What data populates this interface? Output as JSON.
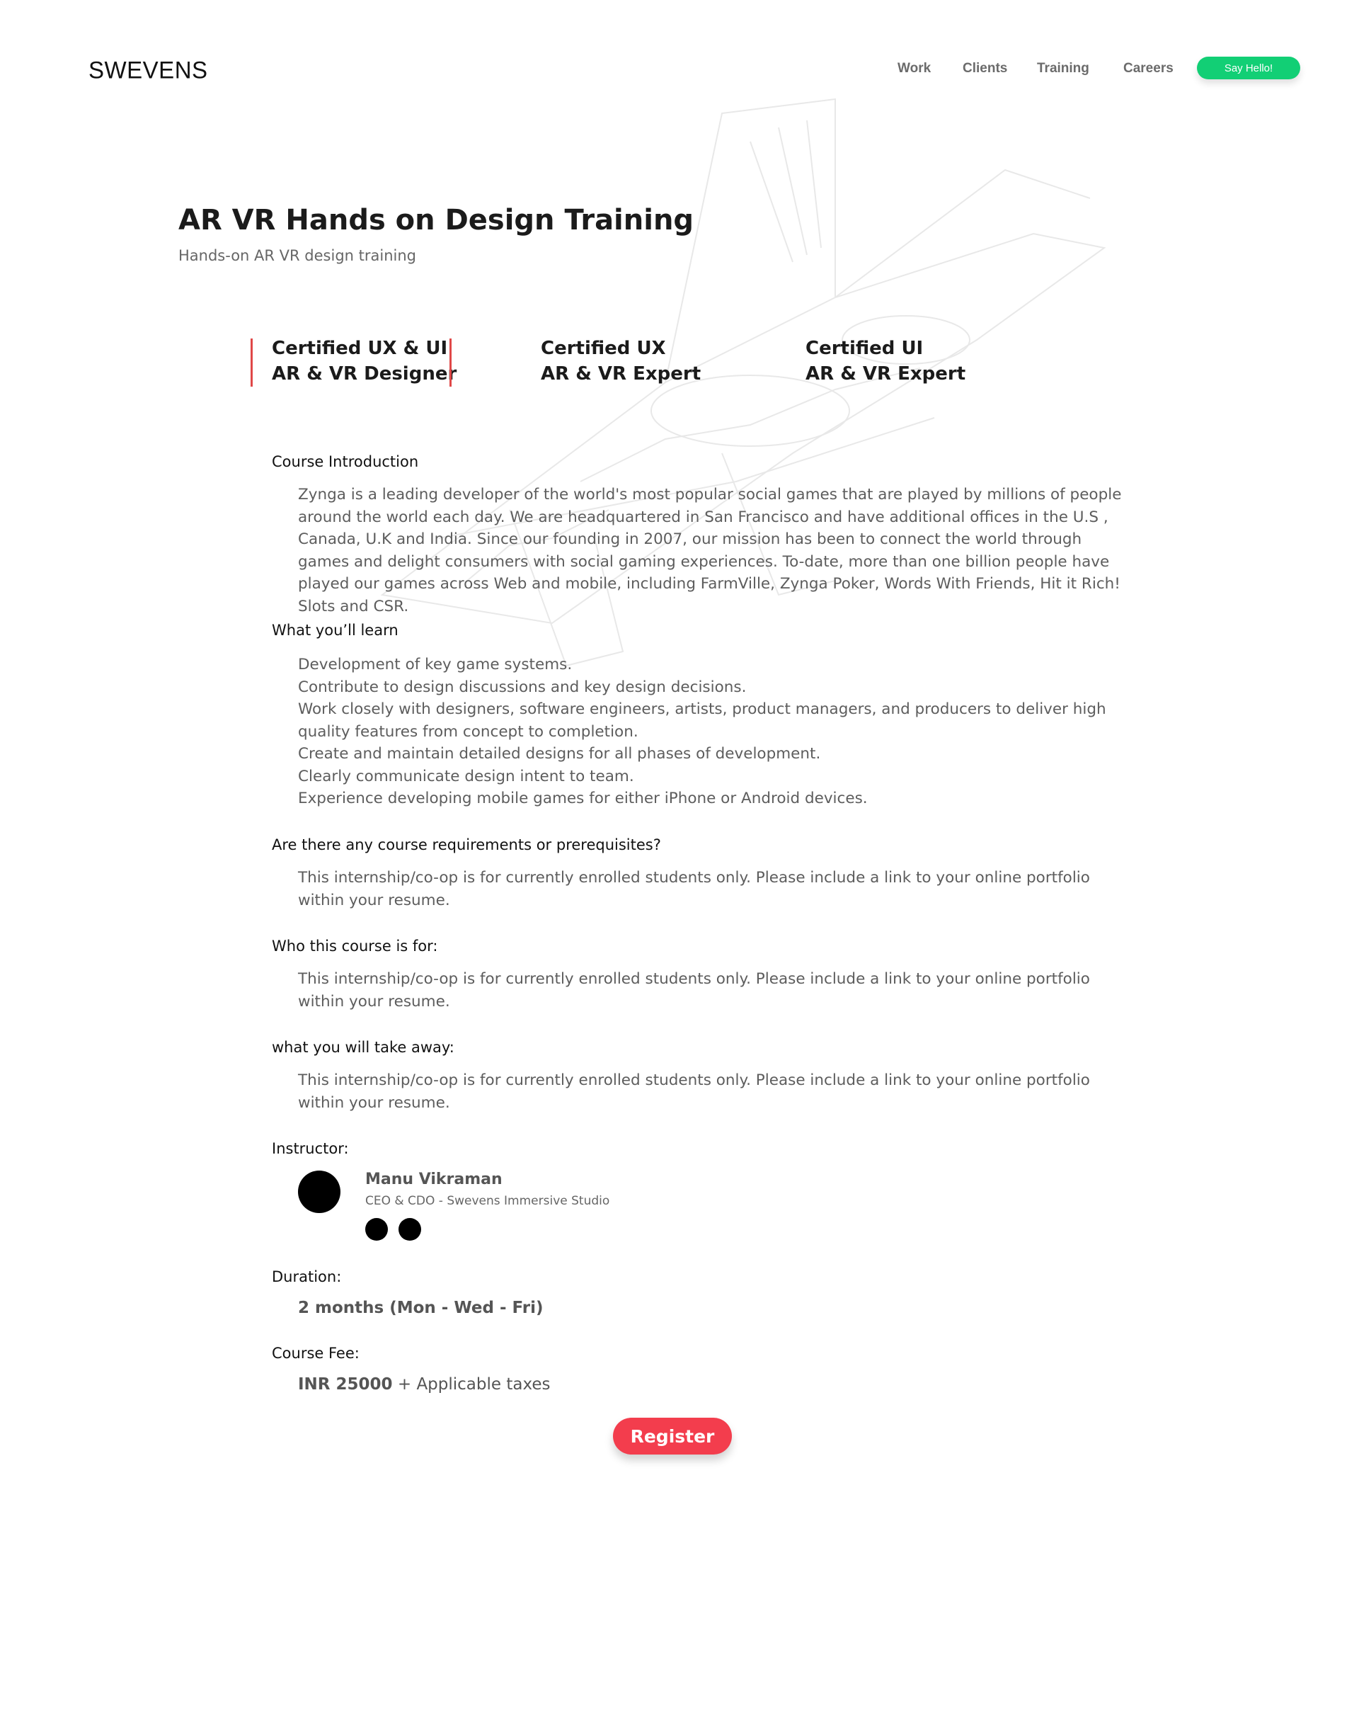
{
  "header": {
    "logo": "SWEVENS",
    "nav": [
      "Work",
      "Clients",
      "Training",
      "Careers"
    ],
    "cta": "Say Hello!"
  },
  "page": {
    "title": "AR VR Hands on Design Training",
    "subtitle": "Hands-on AR VR design training"
  },
  "certifications": [
    {
      "line1": "Certified UX & UI",
      "line2": "AR & VR Designer",
      "selected": true
    },
    {
      "line1": "Certified UX",
      "line2": "AR & VR Expert",
      "selected": false
    },
    {
      "line1": "Certified UI",
      "line2": "AR & VR Expert",
      "selected": false
    }
  ],
  "sections": {
    "intro": {
      "heading": "Course Introduction",
      "text": "Zynga is a leading developer of the world's most popular social games that are played by millions of people around the world each day. We are headquartered in San Francisco and have additional offices in the U.S , Canada, U.K and India. Since our founding in 2007, our mission has been to connect the world through games and delight consumers with social gaming experiences. To-date, more than one billion people have played our games across Web and mobile, including FarmVille, Zynga Poker, Words With Friends, Hit it Rich! Slots and CSR."
    },
    "learn": {
      "heading": "What you’ll learn",
      "items": [
        "Development of key game systems.",
        "Contribute to design discussions and key design decisions.",
        "Work closely with designers, software engineers, artists, product managers, and producers to deliver high quality features from concept to completion.",
        "Create and maintain detailed designs for all phases of development.",
        "Clearly communicate design intent to team.",
        "Experience developing mobile games for either iPhone or Android devices."
      ]
    },
    "requirements": {
      "heading": "Are there any course requirements or prerequisites?",
      "text": "This internship/co-op is for currently enrolled students only. Please include a link to your online portfolio within your resume."
    },
    "audience": {
      "heading": "Who this course is for:",
      "text": "This internship/co-op is for currently enrolled students only. Please include a link to your online portfolio within your resume."
    },
    "takeaway": {
      "heading": "what you will take away:",
      "text": "This internship/co-op is for currently enrolled students only. Please include a link to your online portfolio within your resume."
    },
    "instructor": {
      "heading": "Instructor:",
      "name": "Manu Vikraman",
      "role": "CEO & CDO - Swevens Immersive Studio"
    },
    "duration": {
      "heading": "Duration:",
      "value": "2 months (Mon - Wed - Fri)"
    },
    "fee": {
      "heading": "Course Fee:",
      "amount": "INR 25000",
      "suffix": " + Applicable taxes"
    }
  },
  "register_label": "Register",
  "colors": {
    "accent_green": "#12cf75",
    "accent_red": "#f33d4d",
    "cert_bar": "#e04848"
  }
}
